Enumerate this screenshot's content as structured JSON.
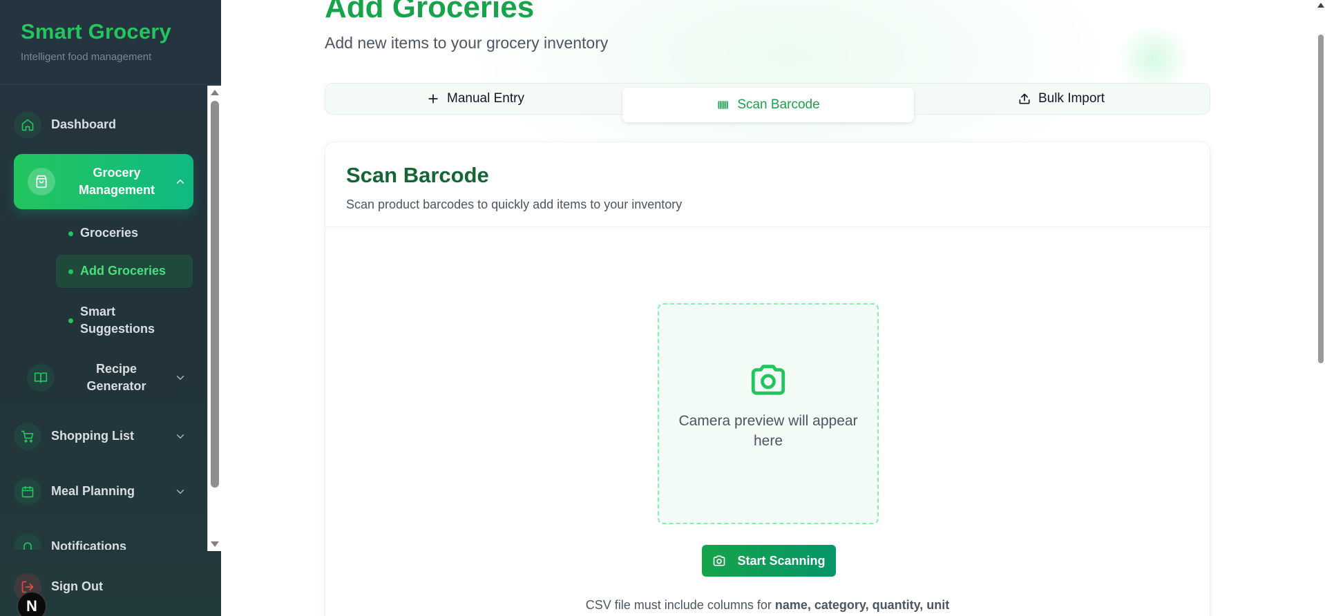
{
  "sidebar": {
    "brand_title": "Smart Grocery",
    "brand_subtitle": "Intelligent food management",
    "items": [
      {
        "label": "Dashboard",
        "icon": "home-icon"
      },
      {
        "label": "Grocery Management",
        "icon": "shopping-bag-icon",
        "expanded": true
      },
      {
        "label": "Recipe Generator",
        "icon": "book-icon"
      },
      {
        "label": "Shopping List",
        "icon": "cart-icon"
      },
      {
        "label": "Meal Planning",
        "icon": "calendar-icon"
      },
      {
        "label": "Notifications",
        "icon": "bell-icon"
      }
    ],
    "subitems": [
      {
        "label": "Groceries"
      },
      {
        "label": "Add Groceries",
        "active": true
      },
      {
        "label": "Smart Suggestions"
      }
    ],
    "sign_out": "Sign Out",
    "badge": "N"
  },
  "header": {
    "title": "Add Groceries",
    "subtitle": "Add new items to your grocery inventory"
  },
  "tabs": [
    {
      "label": "Manual Entry",
      "icon": "plus-icon"
    },
    {
      "label": "Scan Barcode",
      "icon": "barcode-icon",
      "active": true
    },
    {
      "label": "Bulk Import",
      "icon": "upload-icon"
    }
  ],
  "card": {
    "title": "Scan Barcode",
    "subtitle": "Scan product barcodes to quickly add items to your inventory",
    "preview_text": "Camera preview will appear here",
    "button_label": "Start Scanning",
    "csv_note_prefix": "CSV file must include columns for",
    "csv_note_columns": "name, category, quantity, unit"
  },
  "colors": {
    "accent": "#22c55e",
    "accent_dark": "#16a34a",
    "sidebar_bg": "#25343f"
  }
}
